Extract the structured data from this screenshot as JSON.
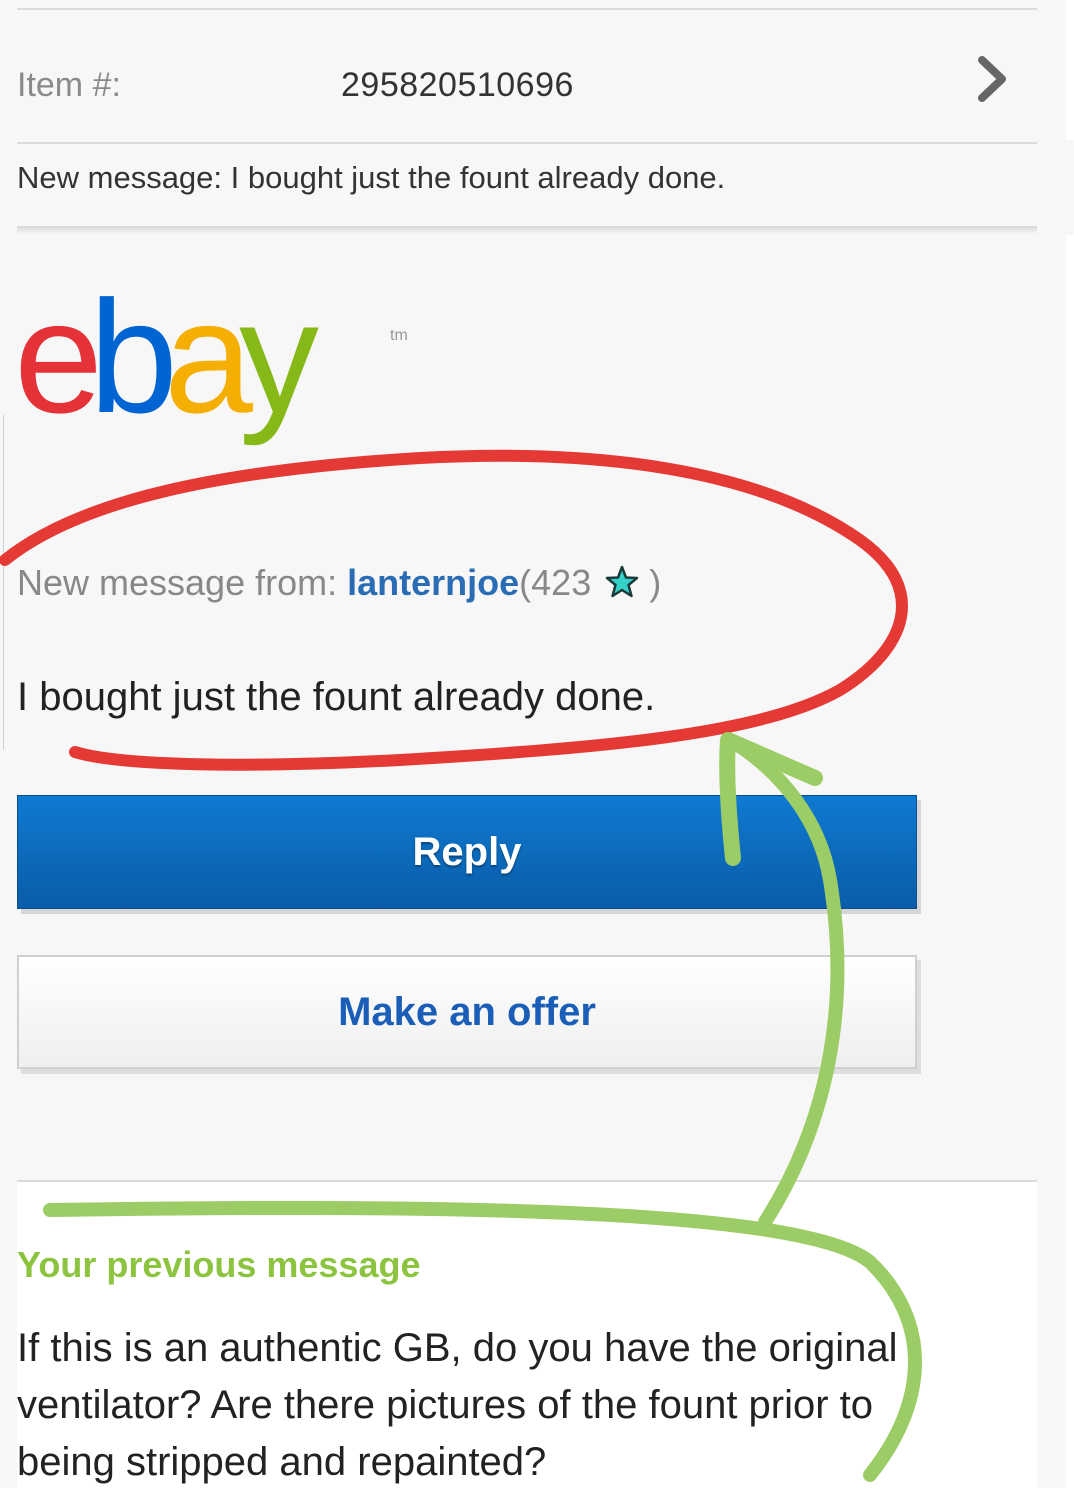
{
  "item": {
    "label": "Item #:",
    "number": "295820510696"
  },
  "subject": "New message: I bought just the fount already done.",
  "logo": {
    "text": "ebay",
    "tm": "tm",
    "colors": [
      "#e53238",
      "#0064d2",
      "#f5af02",
      "#86b817"
    ]
  },
  "message": {
    "from_label": "New message from: ",
    "username": "lanternjoe",
    "score_open": "(423",
    "score_close": ")",
    "star_icon": "turquoise-star-icon",
    "body": "I bought just the fount already done."
  },
  "actions": {
    "reply_label": "Reply",
    "offer_label": "Make an offer"
  },
  "previous": {
    "title": "Your previous message",
    "body": "If this is an authentic GB, do you have the original ventilator? Are there pictures of the fount prior to being stripped and repainted?"
  },
  "colors": {
    "reply_button": "#0a66c2",
    "offer_text": "#1a5eb8",
    "username": "#2a6db5",
    "previous_title": "#8cc43f",
    "annotation_red": "#e53935",
    "annotation_green": "#9ccc65"
  }
}
